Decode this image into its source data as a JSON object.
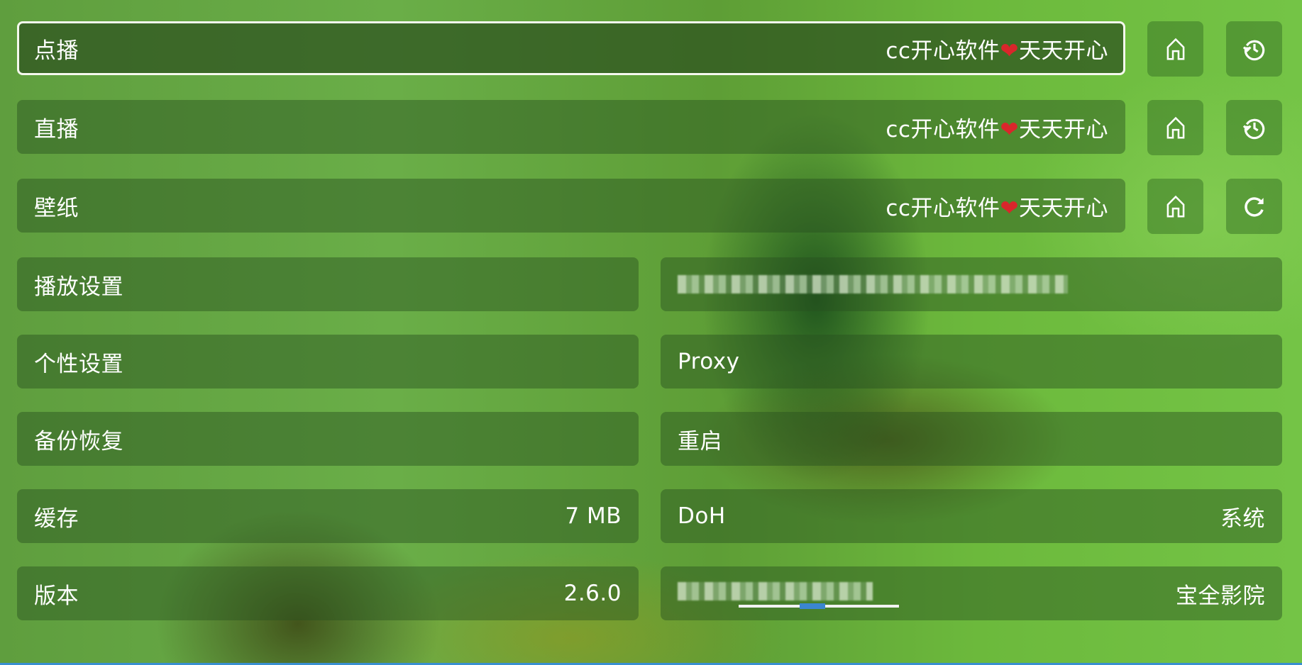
{
  "top_rows": [
    {
      "label": "点播",
      "value_prefix": "cc开心软件",
      "value_heart": "❤",
      "value_suffix": "天天开心",
      "focused": true,
      "buttons": [
        {
          "icon": "home-icon",
          "label": "home"
        },
        {
          "icon": "history-icon",
          "label": "history"
        }
      ]
    },
    {
      "label": "直播",
      "value_prefix": "cc开心软件",
      "value_heart": "❤",
      "value_suffix": "天天开心",
      "focused": false,
      "buttons": [
        {
          "icon": "home-icon",
          "label": "home"
        },
        {
          "icon": "history-icon",
          "label": "history"
        }
      ]
    },
    {
      "label": "壁纸",
      "value_prefix": "cc开心软件",
      "value_heart": "❤",
      "value_suffix": "天天开心",
      "focused": false,
      "buttons": [
        {
          "icon": "home-icon",
          "label": "home"
        },
        {
          "icon": "refresh-icon",
          "label": "refresh"
        }
      ]
    }
  ],
  "left_column": [
    {
      "label": "播放设置",
      "value": ""
    },
    {
      "label": "个性设置",
      "value": ""
    },
    {
      "label": "备份恢复",
      "value": ""
    },
    {
      "label": "缓存",
      "value": "7 MB"
    },
    {
      "label": "版本",
      "value": "2.6.0"
    }
  ],
  "right_column": [
    {
      "label": "[redacted text]",
      "value": "",
      "redacted": true
    },
    {
      "label": "Proxy",
      "value": ""
    },
    {
      "label": "重启",
      "value": ""
    },
    {
      "label": "DoH",
      "value": "系统"
    },
    {
      "label": "[redacted text]",
      "value": "宝全影院",
      "redacted": true,
      "progress_indicator": true
    }
  ],
  "colors": {
    "focus_border": "#f5f8ee",
    "heart": "#d9262b",
    "accent_line": "#3a8fd0",
    "indicator": "#3b86cf"
  }
}
